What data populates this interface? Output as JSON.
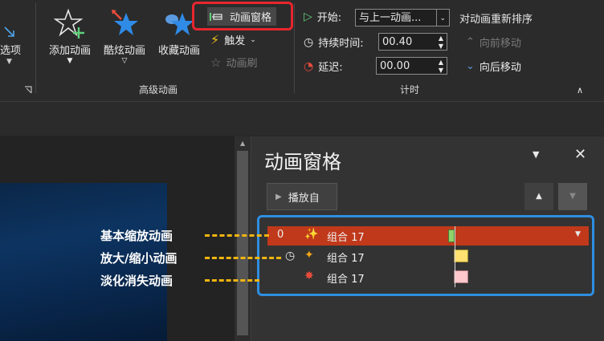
{
  "ribbon": {
    "effect_options_partial": "选项",
    "add_animation": "添加动画",
    "cool_animation": "酷炫动画",
    "favorite_animation": "收藏动画",
    "animation_pane": "动画窗格",
    "trigger": "触发",
    "animation_painter": "动画刷",
    "advanced_group": "高级动画",
    "start_label": "开始:",
    "start_value": "与上一动画...",
    "duration_label": "持续时间:",
    "duration_value": "00.40",
    "delay_label": "延迟:",
    "delay_value": "00.00",
    "timing_group": "计时",
    "reorder_title": "对动画重新排序",
    "move_earlier": "向前移动",
    "move_later": "向后移动"
  },
  "pane": {
    "title": "动画窗格",
    "play_from": "播放自",
    "items": [
      {
        "index": "0",
        "name": "组合 17",
        "timeline_color": "#8fd16a"
      },
      {
        "index": "",
        "name": "组合 17",
        "timeline_color": "#ffe070"
      },
      {
        "index": "",
        "name": "组合 17",
        "timeline_color": "#ffc8cc"
      }
    ]
  },
  "annotations": {
    "label_1": "基本缩放动画",
    "label_2": "放大/缩小动画",
    "label_3": "淡化消失动画"
  },
  "colors": {
    "selected_row": "#c0391b",
    "highlight_red": "#e8262e",
    "highlight_blue": "#2e8ee0",
    "dash_yellow": "#f2b50f"
  }
}
